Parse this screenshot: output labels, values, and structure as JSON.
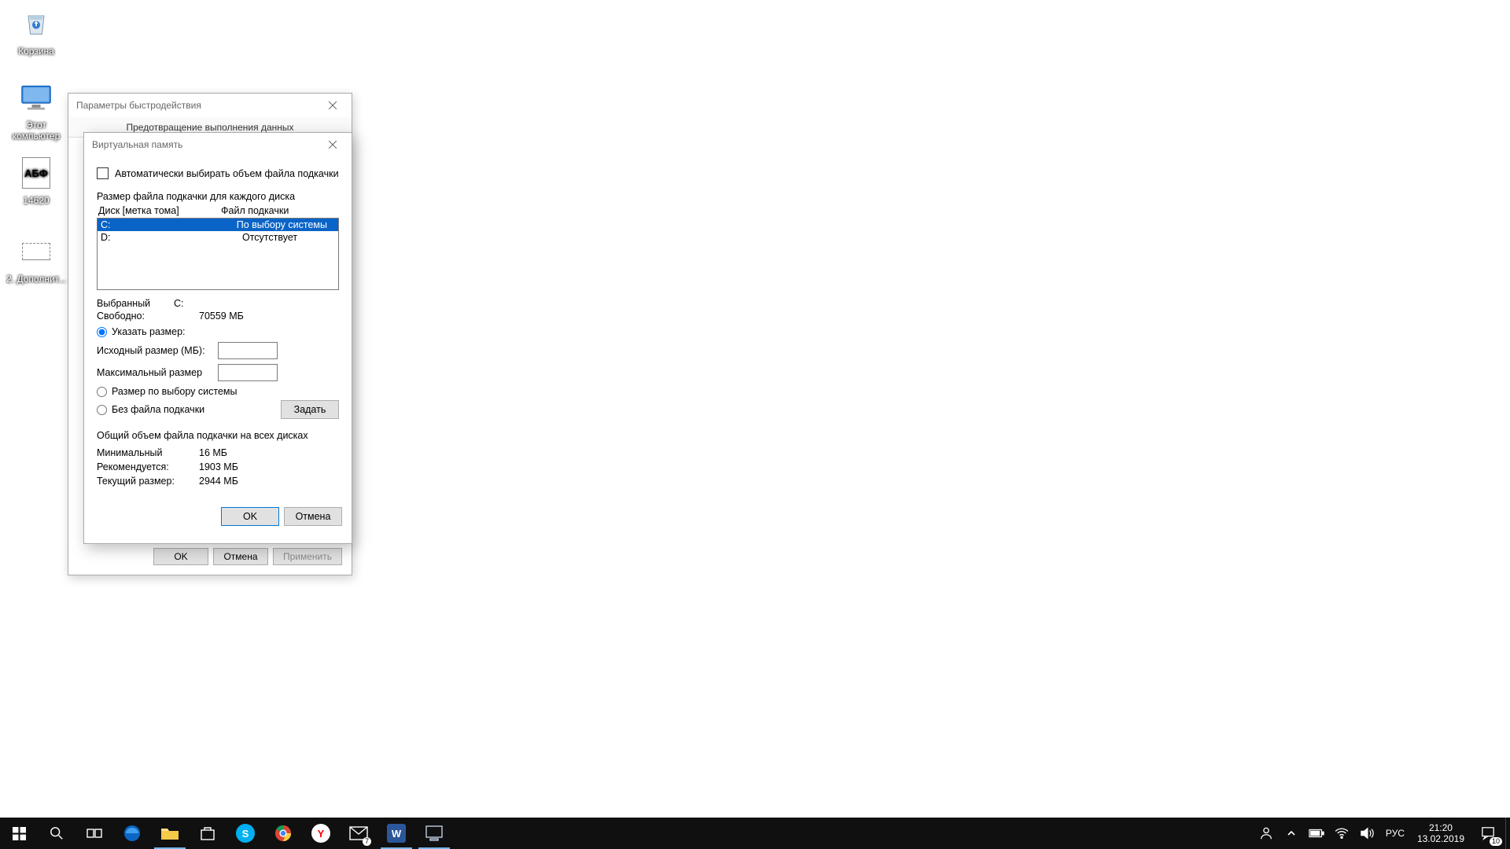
{
  "desktop": {
    "recycle": "Корзина",
    "pc": "Этот компьютер",
    "doc1_glyph": "АБФ",
    "doc1": "14620",
    "doc2": "2. Дополнит..."
  },
  "perfwin": {
    "title": "Параметры быстродействия",
    "tab": "Предотвращение выполнения данных",
    "ok": "OK",
    "cancel": "Отмена",
    "apply": "Применить"
  },
  "vmwin": {
    "title": "Виртуальная память",
    "autochk": "Автоматически выбирать объем файла подкачки",
    "section": "Размер файла подкачки для каждого диска",
    "col1": "Диск [метка тома]",
    "col2": "Файл подкачки",
    "rows": [
      {
        "drive": "C:",
        "page": "По выбору системы"
      },
      {
        "drive": "D:",
        "page": "Отсутствует"
      }
    ],
    "selected_lbl": "Выбранный",
    "selected_val": "C:",
    "free_lbl": "Свободно:",
    "free_val": "70559 МБ",
    "r_custom": "Указать размер:",
    "initial": "Исходный размер (МБ):",
    "maximum": "Максимальный размер",
    "r_system": "Размер по выбору системы",
    "r_none": "Без файла подкачки",
    "set": "Задать",
    "totals_title": "Общий объем файла подкачки на всех дисках",
    "min_lbl": "Минимальный",
    "min_val": "16 МБ",
    "rec_lbl": "Рекомендуется:",
    "rec_val": "1903 МБ",
    "cur_lbl": "Текущий размер:",
    "cur_val": "2944 МБ",
    "ok": "OK",
    "cancel": "Отмена"
  },
  "taskbar": {
    "mail_badge": "7",
    "lang": "РУС",
    "time": "21:20",
    "date": "13.02.2019",
    "notif_badge": "10"
  }
}
